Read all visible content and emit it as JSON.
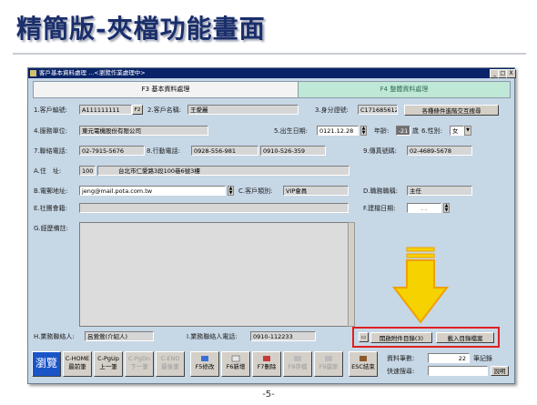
{
  "slide": {
    "title": "精簡版-夾檔功能畫面",
    "page_number": "-5-"
  },
  "window": {
    "title": "客戶基本資料處理 ...<瀏覽作業處理中>",
    "controls": [
      "_",
      "□",
      "X"
    ]
  },
  "tabs": [
    {
      "label": "F3 基本資料處理",
      "active": true
    },
    {
      "label": "F4 整體資料處理",
      "active": false
    }
  ],
  "form": {
    "customer_id": {
      "label": "1.客戶編號:",
      "value": "A111111111",
      "btn": "F2"
    },
    "customer_name": {
      "label": "2.客戶名稱:",
      "value": "王愛麗"
    },
    "id_number": {
      "label": "3.身分證號:",
      "value": "C171685612"
    },
    "cross_search_button": "各種條件進階交互搜尋",
    "company": {
      "label": "4.服務單位:",
      "value": "東元電機股份有限公司"
    },
    "birthday": {
      "label": "5.出生日期:",
      "value": "0121.12.28"
    },
    "age": {
      "label": "年齡:",
      "value": "-21",
      "suffix": "歲"
    },
    "gender": {
      "label": "6.性別:",
      "value": "女"
    },
    "phone": {
      "label": "7.聯絡電話:",
      "value": "02-7915-5676"
    },
    "mobile": {
      "label": "8.行動電話:",
      "value": "0928-556-981",
      "value2": "0910-526-359"
    },
    "fax": {
      "label": "9.傳真號碼:",
      "value": "02-4689-5678"
    },
    "address": {
      "label": "A.住　址:",
      "zip": "100",
      "value": "台北市仁愛路3段100巷6號3樓"
    },
    "email": {
      "label": "B.電郵地址:",
      "value": "jeng@mail.pota.com.tw"
    },
    "customer_type": {
      "label": "C.客戶類別:",
      "value": "VIP會員"
    },
    "job_title": {
      "label": "D.職務職稱:",
      "value": "主任"
    },
    "community": {
      "label": "E.社團會籍:",
      "value": ""
    },
    "created_date": {
      "label": "F.建檔日期:",
      "value": ".  ."
    },
    "history": {
      "label": "G.經歷備註:"
    },
    "sales_contact": {
      "label": "H.業務聯絡人:",
      "value": "呂鶯鶯(介紹人)"
    },
    "sales_phone": {
      "label": "I.業務聯絡人電話:",
      "value": "0910-112233"
    }
  },
  "attach": {
    "open_label": "開啟附件目錄(3)",
    "import_label": "載入目錄檔案"
  },
  "toolbar": [
    {
      "label": "瀏覽",
      "sub": "",
      "disabled": false
    },
    {
      "label": "C-HOME",
      "sub": "最前筆",
      "disabled": false
    },
    {
      "label": "C-PgUp",
      "sub": "上一筆",
      "disabled": false
    },
    {
      "label": "C-PgDn",
      "sub": "下一筆",
      "disabled": true
    },
    {
      "label": "C-END",
      "sub": "最後筆",
      "disabled": true
    },
    {
      "label": "",
      "sub": "F5修改",
      "disabled": false
    },
    {
      "label": "",
      "sub": "F6新增",
      "disabled": false
    },
    {
      "label": "",
      "sub": "F7刪除",
      "disabled": false
    },
    {
      "label": "",
      "sub": "F8存檔",
      "disabled": true
    },
    {
      "label": "",
      "sub": "F9還原",
      "disabled": true
    },
    {
      "label": "",
      "sub": "ESC結束",
      "disabled": false
    }
  ],
  "stats": {
    "record_total_label": "資料筆數:",
    "record_total": "22",
    "record_unit": "筆記錄",
    "quick_search_label": "快速搜尋:",
    "help_button": "說明"
  },
  "colors": {
    "accent_arrow": "#f5d200",
    "highlight": "#e02020",
    "titlebar": "#0a246a"
  }
}
